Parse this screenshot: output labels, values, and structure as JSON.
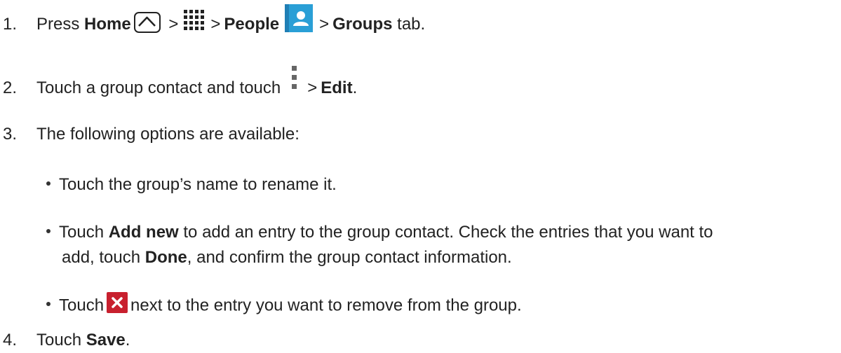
{
  "steps": [
    {
      "num": "1.",
      "pre": "Press",
      "home": "Home",
      "gt1": ">",
      "gt2": ">",
      "people": "People",
      "gt3": ">",
      "groups": "Groups",
      "post": "tab."
    },
    {
      "num": "2.",
      "pre": "Touch a group contact and touch",
      "gt": ">",
      "edit": "Edit",
      "post": "."
    },
    {
      "num": "3.",
      "text": "The following options are available:"
    },
    {
      "num": "4.",
      "pre": "Touch",
      "save": "Save",
      "post": "."
    }
  ],
  "bullets": {
    "rename": "Touch the group’s name to rename it.",
    "addnew": {
      "pre": "Touch",
      "bold": "Add new",
      "post": "to add an entry to the group contact. Check the entries that you want to",
      "line2_pre": "add, touch",
      "line2_bold": "Done",
      "line2_post": ", and confirm the group contact information."
    },
    "remove": {
      "pre": "Touch",
      "post": "next to the entry you want to remove from the group."
    }
  },
  "icons": {
    "home": "home-icon",
    "apps": "apps-grid-icon",
    "people": "people-icon",
    "menu": "menu-dots-icon",
    "remove": "close-icon"
  },
  "colors": {
    "text": "#222222",
    "people_blue": "#2a9fd6",
    "remove_red": "#c8202e"
  }
}
